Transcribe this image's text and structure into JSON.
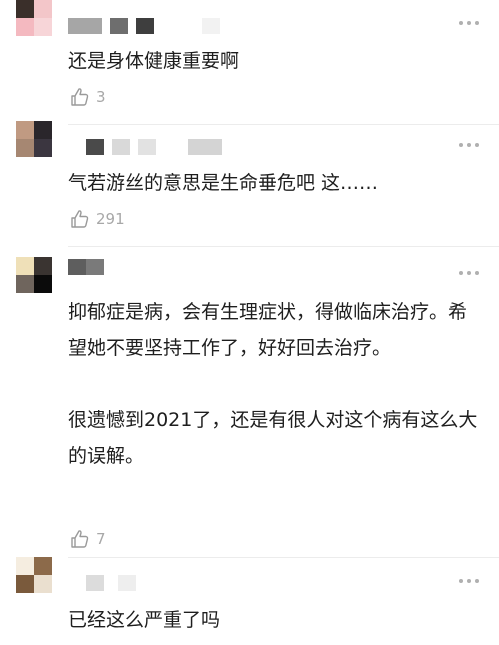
{
  "comments": [
    {
      "text": "还是身体健康重要啊",
      "likes": "3",
      "icons": {
        "like": "thumbs-up-icon",
        "more": "more-dots-icon"
      },
      "avatar_colors": [
        "#3a2f2a",
        "#f3c6c9",
        "#f4b9c0",
        "#f7d5d8"
      ],
      "name_colors": [
        "#a6a6a6",
        "#6e6e6e",
        "#3e3e3e",
        "#f2f2f2"
      ]
    },
    {
      "text": "气若游丝的意思是生命垂危吧 这……",
      "likes": "291",
      "icons": {
        "like": "thumbs-up-icon",
        "more": "more-dots-icon"
      },
      "avatar_colors": [
        "#c09a82",
        "#2a262b",
        "#a68772",
        "#3b3640"
      ],
      "name_colors": [
        "#4a4a4a",
        "#d9d9d9",
        "#e2e2e2",
        "#d4d4d4"
      ]
    },
    {
      "text": "抑郁症是病，会有生理症状，得做临床治疗。希望她不要坚持工作了，好好回去治疗。\n\n很遗憾到2021了，还是有很人对这个病有这么大的误解。",
      "likes": "7",
      "icons": {
        "like": "thumbs-up-icon",
        "more": "more-dots-icon"
      },
      "avatar_colors": [
        "#efe0b8",
        "#3a3431",
        "#6f655d",
        "#0b0b0b"
      ],
      "name_colors": [
        "#5e5e5e",
        "#7a7a7a"
      ]
    },
    {
      "text": "已经这么严重了吗",
      "likes": "",
      "icons": {
        "like": "thumbs-up-icon",
        "more": "more-dots-icon"
      },
      "avatar_colors": [
        "#f5ede0",
        "#8c6a4a",
        "#7a5a3c",
        "#eadfcf"
      ],
      "name_colors": [
        "#dcdcdc",
        "#eeeeee"
      ]
    }
  ]
}
